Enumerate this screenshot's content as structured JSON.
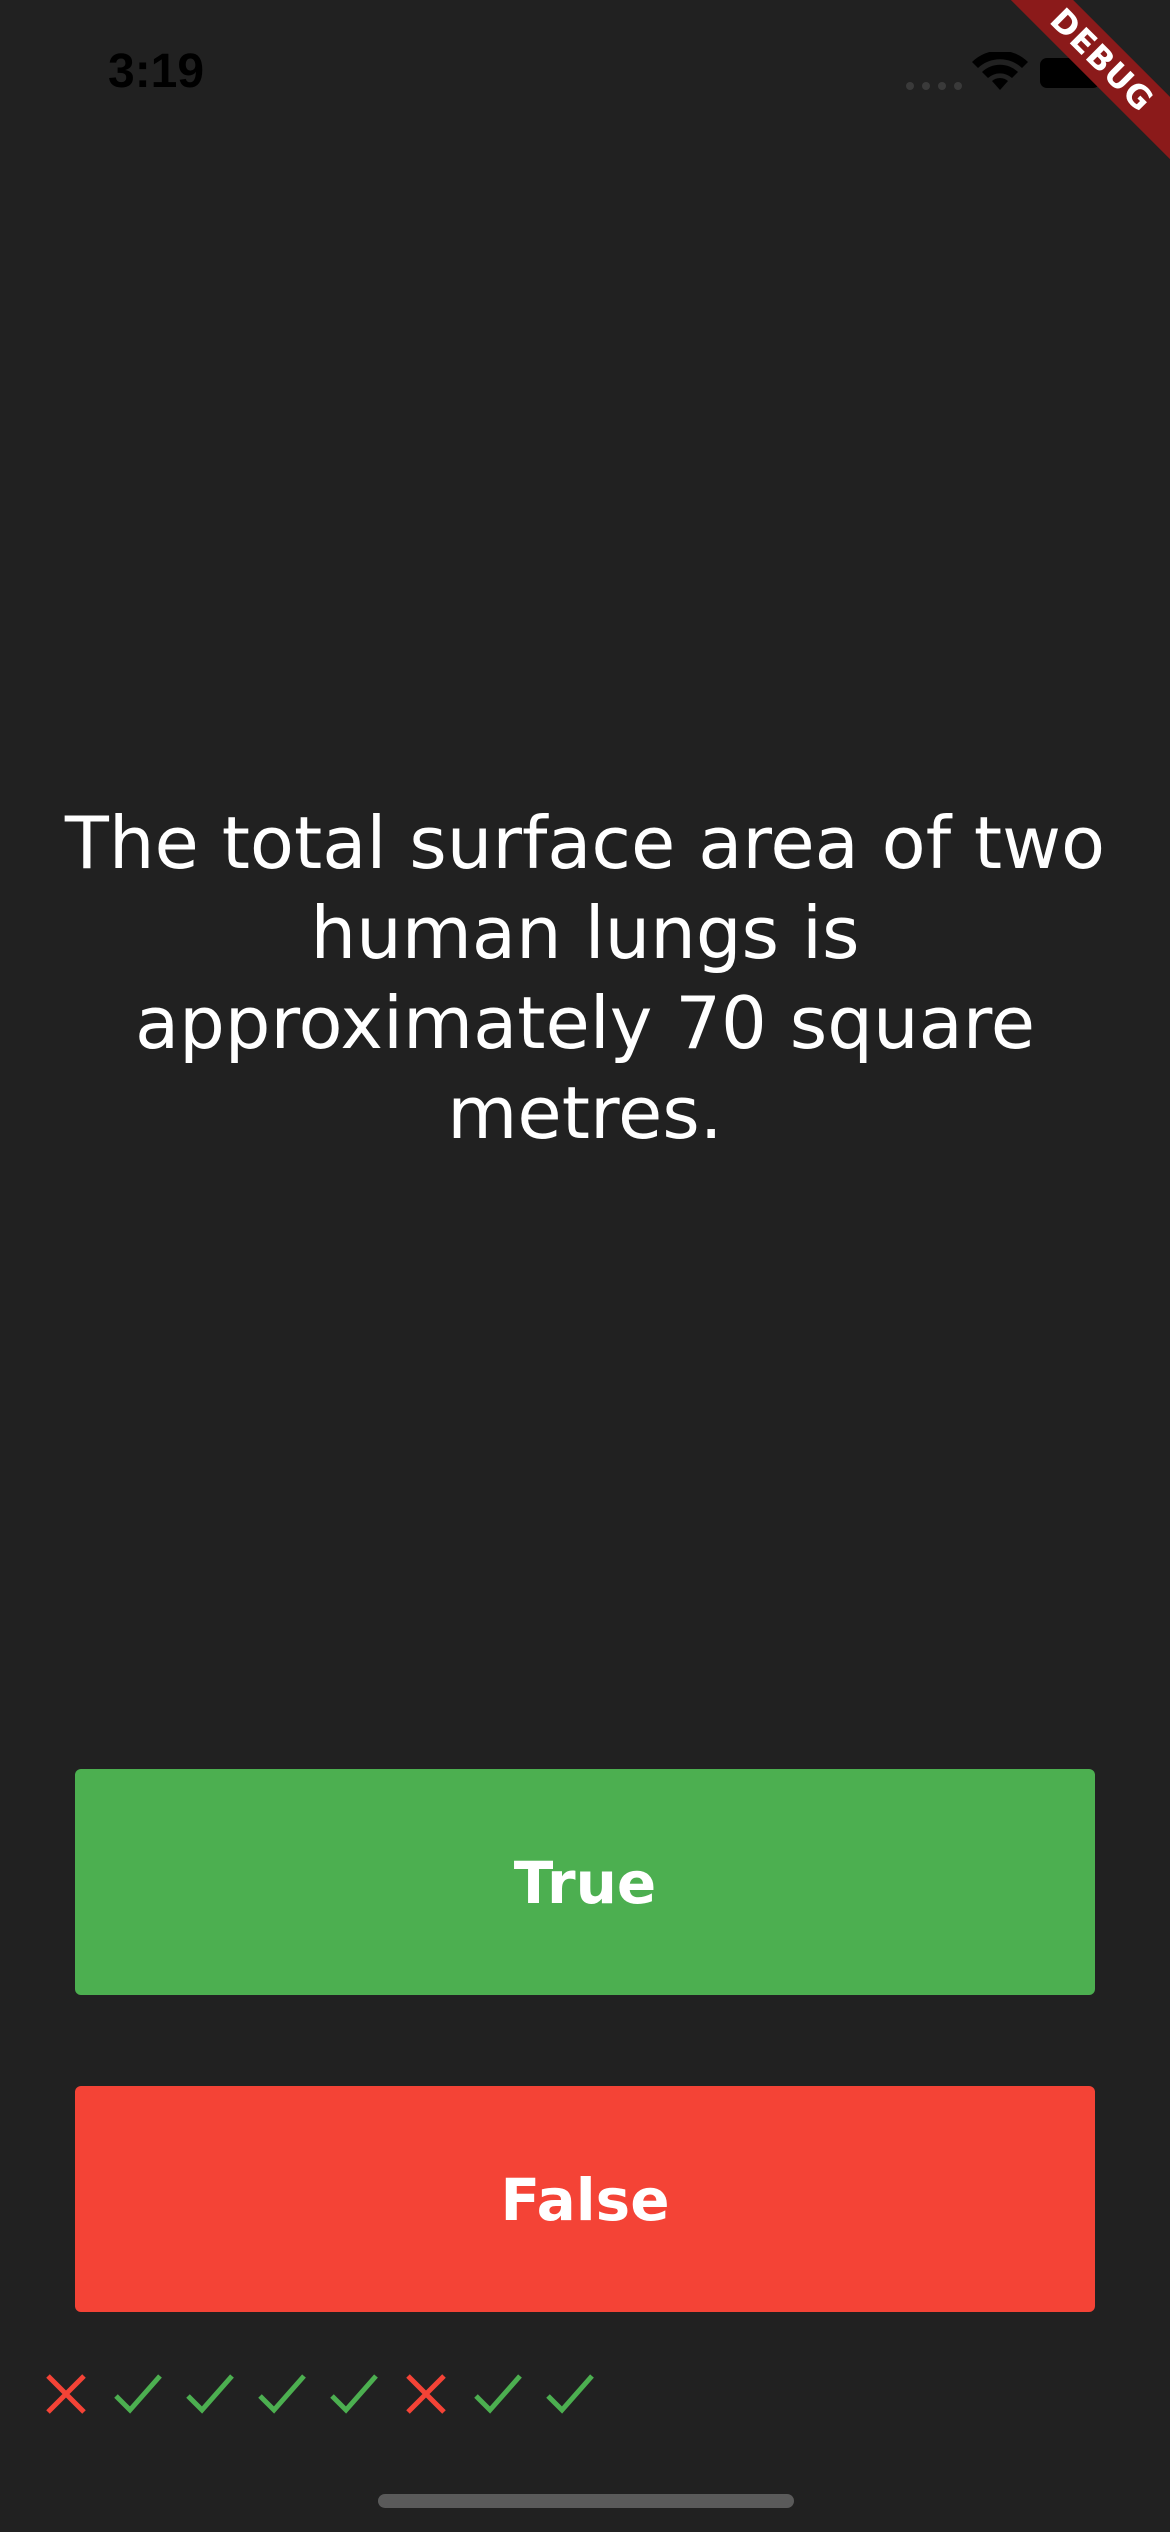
{
  "status_bar": {
    "time": "3:19",
    "icons": [
      "signal-icon",
      "wifi-icon",
      "battery-icon"
    ]
  },
  "debug_banner": {
    "label": "DEBUG",
    "color": "#8b1a1a"
  },
  "question": {
    "text": "The total surface area of two human lungs is approximately 70 square metres."
  },
  "buttons": {
    "true_label": "True",
    "false_label": "False",
    "true_color": "#4caf50",
    "false_color": "#f44336"
  },
  "score_keeper": {
    "results": [
      "wrong",
      "correct",
      "correct",
      "correct",
      "correct",
      "wrong",
      "correct",
      "correct"
    ],
    "icons": {
      "correct": "check-icon",
      "wrong": "close-icon"
    },
    "colors": {
      "correct": "#4caf50",
      "wrong": "#f44336"
    }
  },
  "colors": {
    "background": "#212121",
    "text": "#ffffff"
  }
}
